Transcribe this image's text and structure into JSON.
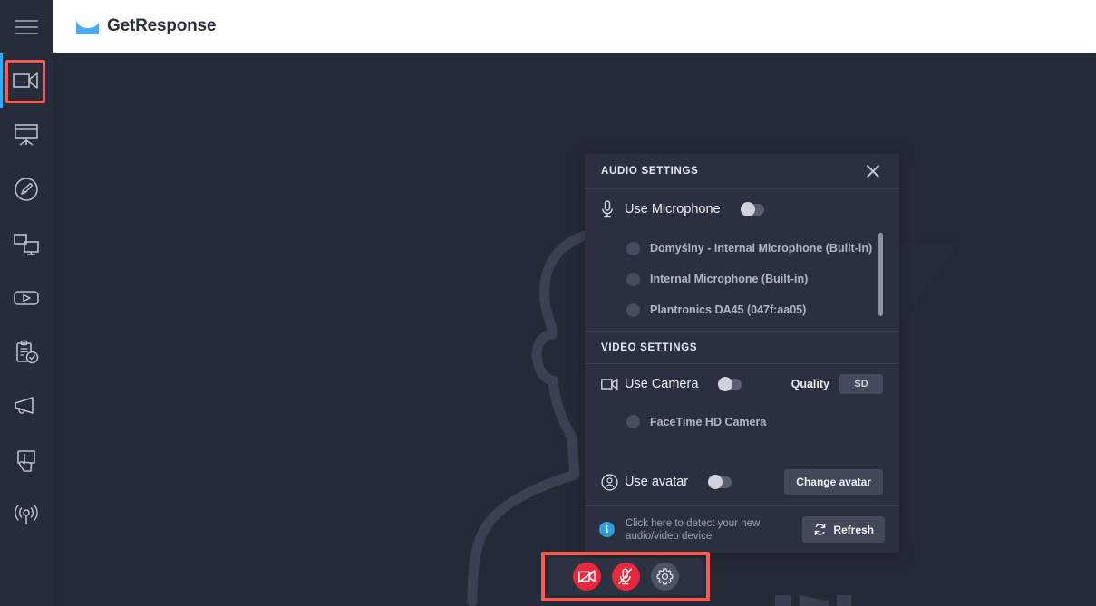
{
  "header": {
    "menu_icon": "hamburger-icon",
    "brand_name": "GetResponse",
    "brand_icon": "envelope-icon"
  },
  "sidebar": {
    "items": [
      {
        "icon": "video-camera-icon",
        "name": "camera",
        "active": true
      },
      {
        "icon": "presentation-board-icon",
        "name": "whiteboard",
        "active": false
      },
      {
        "icon": "pencil-circle-icon",
        "name": "annotate",
        "active": false
      },
      {
        "icon": "screen-share-icon",
        "name": "screen-share",
        "active": false
      },
      {
        "icon": "video-player-icon",
        "name": "media",
        "active": false
      },
      {
        "icon": "clipboard-check-icon",
        "name": "poll",
        "active": false
      },
      {
        "icon": "megaphone-icon",
        "name": "announce",
        "active": false
      },
      {
        "icon": "cta-click-icon",
        "name": "call-to-action",
        "active": false
      },
      {
        "icon": "broadcast-icon",
        "name": "broadcast",
        "active": false
      }
    ]
  },
  "panel": {
    "audio": {
      "title": "AUDIO SETTINGS",
      "close_icon": "close-icon",
      "toggle_label": "Use Microphone",
      "toggle_icon": "microphone-icon",
      "toggle_on": false,
      "devices": [
        "Domyślny - Internal Microphone (Built-in)",
        "Internal Microphone (Built-in)",
        "Plantronics DA45 (047f:aa05)"
      ]
    },
    "video": {
      "title": "VIDEO SETTINGS",
      "toggle_label": "Use Camera",
      "toggle_icon": "video-camera-icon",
      "toggle_on": false,
      "quality_label": "Quality",
      "quality_value": "SD",
      "devices": [
        "FaceTime HD Camera"
      ],
      "avatar_label": "Use avatar",
      "avatar_icon": "user-circle-icon",
      "avatar_toggle_on": false,
      "change_avatar_label": "Change avatar"
    },
    "footer": {
      "info_icon": "info-icon",
      "text": "Click here to detect your new audio/video device",
      "refresh_label": "Refresh",
      "refresh_icon": "refresh-icon"
    }
  },
  "controls": {
    "buttons": [
      {
        "name": "camera-off-button",
        "icon": "video-camera-off-icon",
        "state": "off"
      },
      {
        "name": "microphone-off-button",
        "icon": "microphone-off-icon",
        "state": "off"
      },
      {
        "name": "settings-button",
        "icon": "gear-icon",
        "state": "default"
      }
    ]
  },
  "colors": {
    "highlight": "#fc5a4e",
    "accent": "#34a9f2",
    "danger": "#e8283c",
    "panel_bg": "#2a3040",
    "stage_bg": "#252a37"
  }
}
